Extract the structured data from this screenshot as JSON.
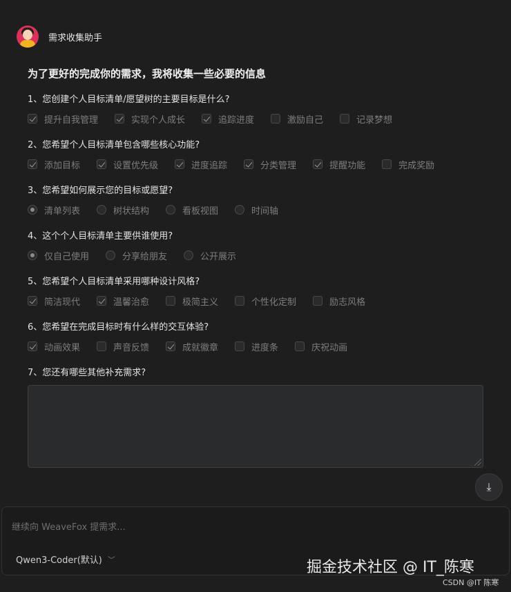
{
  "assistant": {
    "name": "需求收集助手"
  },
  "form": {
    "title": "为了更好的完成你的需求，我将收集一些必要的信息",
    "questions": [
      {
        "label": "1、您创建个人目标清单/愿望树的主要目标是什么?",
        "type": "checkbox",
        "options": [
          {
            "label": "提升自我管理",
            "checked": true
          },
          {
            "label": "实现个人成长",
            "checked": true
          },
          {
            "label": "追踪进度",
            "checked": true
          },
          {
            "label": "激励自己",
            "checked": false
          },
          {
            "label": "记录梦想",
            "checked": false
          }
        ]
      },
      {
        "label": "2、您希望个人目标清单包含哪些核心功能?",
        "type": "checkbox",
        "options": [
          {
            "label": "添加目标",
            "checked": true
          },
          {
            "label": "设置优先级",
            "checked": true
          },
          {
            "label": "进度追踪",
            "checked": true
          },
          {
            "label": "分类管理",
            "checked": true
          },
          {
            "label": "提醒功能",
            "checked": true
          },
          {
            "label": "完成奖励",
            "checked": false
          }
        ]
      },
      {
        "label": "3、您希望如何展示您的目标或愿望?",
        "type": "radio",
        "options": [
          {
            "label": "清单列表",
            "checked": true
          },
          {
            "label": "树状结构",
            "checked": false
          },
          {
            "label": "看板视图",
            "checked": false
          },
          {
            "label": "时间轴",
            "checked": false
          }
        ]
      },
      {
        "label": "4、这个个人目标清单主要供谁使用?",
        "type": "radio",
        "options": [
          {
            "label": "仅自己使用",
            "checked": true
          },
          {
            "label": "分享给朋友",
            "checked": false
          },
          {
            "label": "公开展示",
            "checked": false
          }
        ]
      },
      {
        "label": "5、您希望个人目标清单采用哪种设计风格?",
        "type": "checkbox",
        "options": [
          {
            "label": "简洁现代",
            "checked": true
          },
          {
            "label": "温馨治愈",
            "checked": true
          },
          {
            "label": "极简主义",
            "checked": false
          },
          {
            "label": "个性化定制",
            "checked": false
          },
          {
            "label": "励志风格",
            "checked": false
          }
        ]
      },
      {
        "label": "6、您希望在完成目标时有什么样的交互体验?",
        "type": "checkbox",
        "options": [
          {
            "label": "动画效果",
            "checked": true
          },
          {
            "label": "声音反馈",
            "checked": false
          },
          {
            "label": "成就徽章",
            "checked": true
          },
          {
            "label": "进度条",
            "checked": false
          },
          {
            "label": "庆祝动画",
            "checked": false
          }
        ]
      },
      {
        "label": "7、您还有哪些其他补充需求?",
        "type": "text"
      }
    ]
  },
  "scroll_button": {
    "icon": "arrow-down-to-line-icon",
    "glyph": "⤓"
  },
  "composer": {
    "placeholder": "继续向 WeaveFox 提需求...",
    "model": "Qwen3-Coder(默认)",
    "model_chevron": "﹀"
  },
  "watermark": "掘金技术社区 @ IT_陈寒",
  "credit": "CSDN @IT 陈寒"
}
